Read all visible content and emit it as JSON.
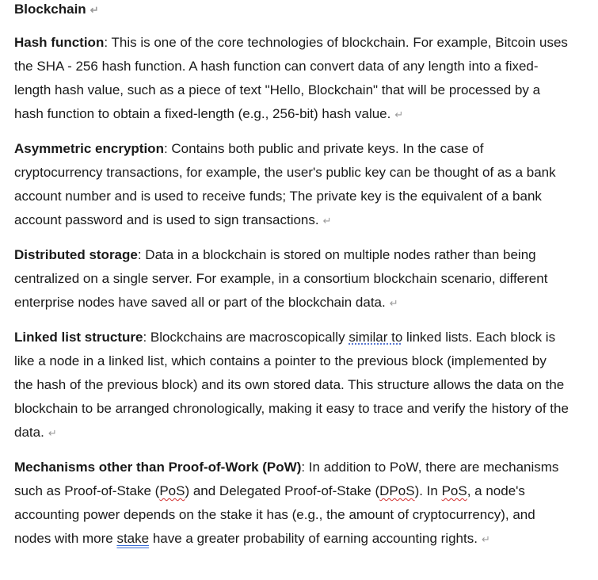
{
  "doc": {
    "title": "Blockchain",
    "paragraph_mark": "↵",
    "hash": {
      "term": "Hash function",
      "body": ": This is one of the core technologies of blockchain. For example, Bitcoin uses the SHA - 256 hash function. A hash function can convert data of any length into a fixed-length hash value, such as a piece of text \"Hello, Blockchain\" that will be processed by a hash function to obtain a fixed-length (e.g., 256-bit) hash value."
    },
    "asym": {
      "term": "Asymmetric encryption",
      "body": ": Contains both public and private keys. In the case of cryptocurrency transactions, for example, the user's public key can be thought of as a bank account number and is used to receive funds; The private key is the equivalent of a bank account password and is used to sign transactions."
    },
    "dist": {
      "term": "Distributed storage",
      "body": ": Data in a blockchain is stored on multiple nodes rather than being centralized on a single server. For example, in a consortium blockchain scenario, different enterprise nodes have saved all or part of the blockchain data."
    },
    "linked": {
      "term": "Linked list structure",
      "body_a": ": Blockchains are macroscopically ",
      "body_b": "similar to",
      "body_c": " linked lists. Each block is like a node in a linked list, which contains a pointer to the previous block (implemented by the hash of the previous block) and its own stored data. This structure allows the data on the blockchain to be arranged chronologically, making it easy to trace and verify the history of the data."
    },
    "mech": {
      "term": "Mechanisms other than Proof-of-Work (PoW)",
      "t1": ": In addition to PoW, there are mechanisms such as Proof-of-Stake (",
      "t2": "PoS",
      "t3": ") and Delegated Proof-of-Stake (",
      "t4": "DPoS",
      "t5": "). In ",
      "t6": "PoS",
      "t7": ", a node's accounting power depends on the stake it has (e.g., the amount of cryptocurrency), and nodes with more ",
      "t8": "stake",
      "t9": " have a greater probability of earning accounting rights."
    }
  }
}
